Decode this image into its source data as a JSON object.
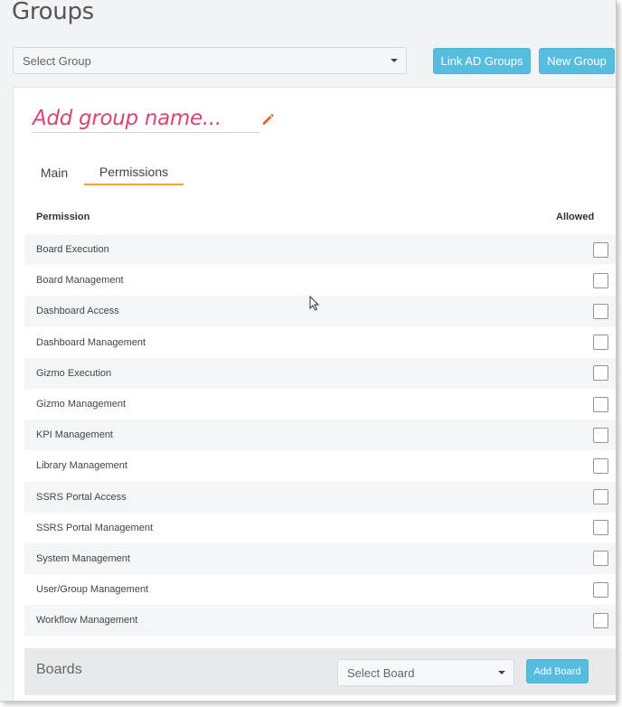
{
  "page": {
    "title": "Groups"
  },
  "toolbar": {
    "select_group_placeholder": "Select Group",
    "link_ad_groups_label": "Link AD Groups",
    "new_group_label": "New Group"
  },
  "group_form": {
    "name_placeholder": "Add group name..."
  },
  "tabs": [
    {
      "label": "Main",
      "active": false
    },
    {
      "label": "Permissions",
      "active": true
    }
  ],
  "permissions_table": {
    "headers": {
      "permission": "Permission",
      "allowed": "Allowed"
    },
    "rows": [
      {
        "name": "Board Execution",
        "allowed": false
      },
      {
        "name": "Board Management",
        "allowed": false
      },
      {
        "name": "Dashboard Access",
        "allowed": false
      },
      {
        "name": "Dashboard Management",
        "allowed": false
      },
      {
        "name": "Gizmo Execution",
        "allowed": false
      },
      {
        "name": "Gizmo Management",
        "allowed": false
      },
      {
        "name": "KPI Management",
        "allowed": false
      },
      {
        "name": "Library Management",
        "allowed": false
      },
      {
        "name": "SSRS Portal Access",
        "allowed": false
      },
      {
        "name": "SSRS Portal Management",
        "allowed": false
      },
      {
        "name": "System Management",
        "allowed": false
      },
      {
        "name": "User/Group Management",
        "allowed": false
      },
      {
        "name": "Workflow Management",
        "allowed": false
      }
    ]
  },
  "boards": {
    "label": "Boards",
    "select_placeholder": "Select Board",
    "add_button_label": "Add Board"
  },
  "colors": {
    "accent_button": "#57bde0",
    "tab_underline": "#f3a536",
    "group_name_text": "#d9456f",
    "pencil_icon": "#e8602c"
  }
}
